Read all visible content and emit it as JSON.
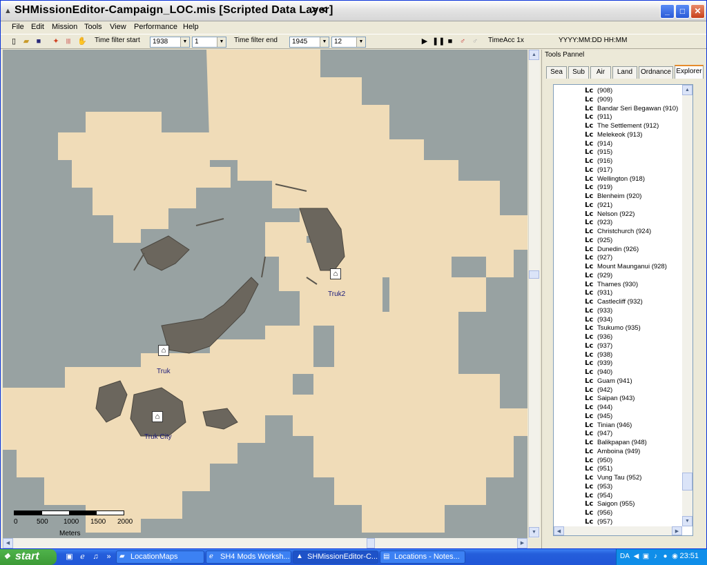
{
  "window": {
    "title": "SHMissionEditor-Campaign_LOC.mis [Scripted Data Layer]",
    "title_extra": "> <"
  },
  "menu": [
    "File",
    "Edit",
    "Mission",
    "Tools",
    "View",
    "Performance",
    "Help"
  ],
  "toolbar": {
    "time_filter_start_label": "Time filter start",
    "start_year": "1938",
    "start_month": "1",
    "time_filter_end_label": "Time filter end",
    "end_year": "1945",
    "end_month": "12",
    "time_acc": "TimeAcc 1x",
    "date_format": "YYYY:MM:DD HH:MM"
  },
  "map": {
    "labels": {
      "truk2": "Truk2",
      "truk": "Truk",
      "truk_city": "Truk City"
    },
    "scale": {
      "ticks": [
        "0",
        "500",
        "1000",
        "1500",
        "2000"
      ],
      "unit": "Meters"
    },
    "colors": {
      "water": "#98a2a2",
      "land": "#f0dcb8",
      "docks": "#6b665d"
    }
  },
  "panel": {
    "title": "Tools Pannel",
    "tabs": [
      "Sea",
      "Sub",
      "Air",
      "Land",
      "Ordnance",
      "Explorer"
    ],
    "active_tab": "Explorer",
    "tree_prefix": "Lc",
    "tree": [
      "(908)",
      "(909)",
      "Bandar Seri Begawan (910)",
      "(911)",
      "The Settlement (912)",
      "Melekeok (913)",
      "(914)",
      "(915)",
      "(916)",
      "(917)",
      "Wellington (918)",
      "(919)",
      "Blenheim (920)",
      "(921)",
      "Nelson (922)",
      "(923)",
      "Christchurch (924)",
      "(925)",
      "Dunedin (926)",
      "(927)",
      "Mount Maunganui (928)",
      "(929)",
      "Thames (930)",
      "(931)",
      "Castlecliff (932)",
      "(933)",
      "(934)",
      "Tsukumo (935)",
      "(936)",
      "(937)",
      "(938)",
      "(939)",
      "(940)",
      "Guam (941)",
      "(942)",
      "Saipan (943)",
      "(944)",
      "(945)",
      "Tinian (946)",
      "(947)",
      "Balikpapan (948)",
      "Amboina (949)",
      "(950)",
      "(951)",
      "Vung Tau (952)",
      "(953)",
      "(954)",
      "Saigon (955)",
      "(956)",
      "(957)"
    ]
  },
  "taskbar": {
    "start_label": "start",
    "tasks": [
      "LocationMaps",
      "SH4 Mods Worksh...",
      "SHMissionEditor-C...",
      "Locations - Notes..."
    ],
    "active_task": 2,
    "tray_text": "DA",
    "clock": "23:51",
    "chevron": "»"
  }
}
